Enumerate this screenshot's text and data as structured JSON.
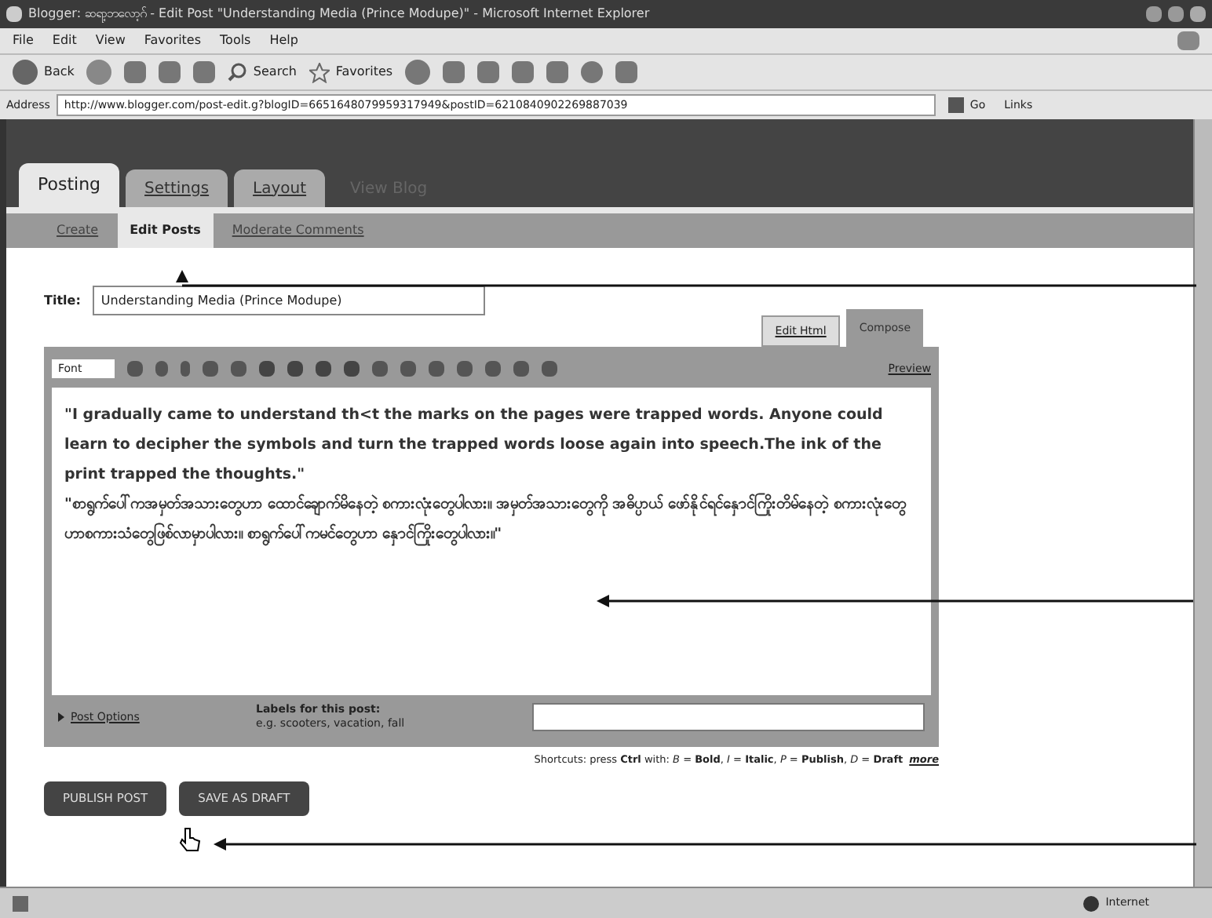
{
  "window": {
    "title": "Blogger: ဆရာ့ဘလော့ဂ် - Edit Post \"Understanding Media (Prince Modupe)\" - Microsoft Internet Explorer"
  },
  "menu": [
    "File",
    "Edit",
    "View",
    "Favorites",
    "Tools",
    "Help"
  ],
  "toolbar": {
    "back": "Back",
    "search": "Search",
    "favorites": "Favorites"
  },
  "address": {
    "label": "Address",
    "url": "http://www.blogger.com/post-edit.g?blogID=6651648079959317949&postID=6210840902269887039",
    "go": "Go",
    "links": "Links"
  },
  "tabs": [
    {
      "label": "Posting",
      "selected": true
    },
    {
      "label": "Settings",
      "selected": false
    },
    {
      "label": "Layout",
      "selected": false
    },
    {
      "label": "View Blog",
      "selected": false
    }
  ],
  "subtabs": [
    {
      "label": "Create",
      "selected": false
    },
    {
      "label": "Edit Posts",
      "selected": true
    },
    {
      "label": "Moderate Comments",
      "selected": false
    }
  ],
  "post": {
    "title_label": "Title:",
    "title": "Understanding Media (Prince Modupe)",
    "modes": [
      {
        "label": "Edit Html",
        "selected": false
      },
      {
        "label": "Compose",
        "selected": true
      }
    ],
    "font": "Font",
    "preview": "Preview",
    "body": [
      "\"I gradually came to understand th<t the marks on the pages were trapped words. Anyone could learn to decipher the symbols and turn the trapped words loose again into speech.The ink of the print trapped the thoughts.\"",
      "\"စာရွက်ပေါ်ကအမှတ်အသားတွေဟာ ထောင်ချောက်မိနေတဲ့ စကားလုံးတွေပါလား။ အမှတ်အသားတွေကို အဓိပ္ပာယ် ဖော်နိုင်ရင်နှောင်ကြိုးတိမ်နေတဲ့ စကားလုံးတွေဟာစကားသံတွေဖြစ်လာမှာပါလား။ စာရွက်ပေါ်ကမင်တွေဟာ နှောင်ကြိုးတွေပါလား။\""
    ],
    "post_options": "Post Options",
    "labels_label": "Labels for this post:",
    "labels_hint": "e.g. scooters, vacation, fall",
    "shortcuts": "Shortcuts: press **Ctrl** with: *B* = **Bold**, *I* = **Italic**, *P* = **Publish**, *D* = **Draft**",
    "more": "more"
  },
  "buttons": [
    {
      "label": "PUBLISH POST"
    },
    {
      "label": "SAVE AS DRAFT"
    }
  ],
  "status_bar": {
    "zone": "Internet"
  }
}
